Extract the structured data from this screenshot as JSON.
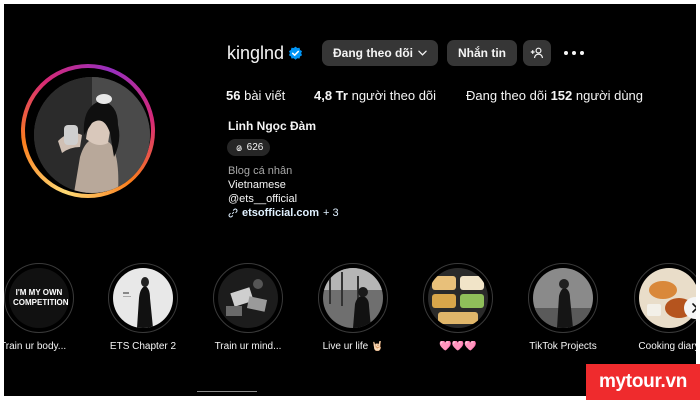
{
  "profile": {
    "username": "kinglnd",
    "follow_button": "Đang theo dõi",
    "message_button": "Nhắn tin",
    "stats": {
      "posts_count": "56",
      "posts_label": "bài viết",
      "followers_count": "4,8 Tr",
      "followers_label": "người theo dõi",
      "following_prefix": "Đang theo dõi",
      "following_count": "152",
      "following_label": "người dùng"
    },
    "full_name": "Linh Ngọc Đàm",
    "threads_count": "626",
    "category": "Blog cá nhân",
    "bio_lines": [
      "Vietnamese",
      "@ets__official"
    ],
    "link": "etsofficial.com",
    "link_extra": "+ 3"
  },
  "highlights": [
    {
      "label": "Train ur body...",
      "cover_text": "I'M MY OWN COMPETITION"
    },
    {
      "label": "ETS Chapter 2"
    },
    {
      "label": "Train ur mind..."
    },
    {
      "label": "Live ur life 🤘🏻"
    },
    {
      "label": "🩷🩷🩷"
    },
    {
      "label": "TikTok Projects"
    },
    {
      "label": "Cooking diary"
    }
  ],
  "watermark": "mytour.vn",
  "colors": {
    "background": "#000000",
    "button": "#363636",
    "verified": "#0095f6",
    "watermark": "#ef2b2d"
  },
  "icons": [
    "verified-badge-icon",
    "chevron-down-icon",
    "add-person-icon",
    "more-options-icon",
    "threads-icon",
    "link-icon",
    "chevron-right-icon"
  ]
}
